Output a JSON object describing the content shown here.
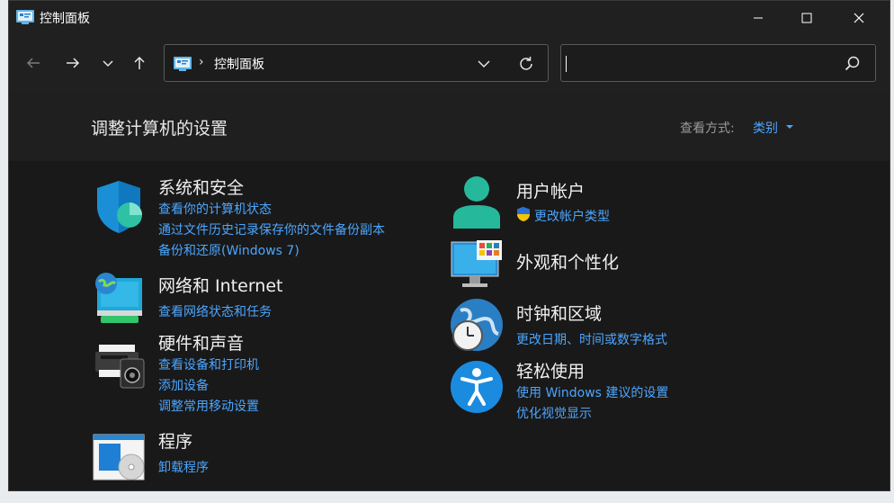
{
  "window": {
    "title": "控制面板",
    "controls": [
      "minimize-icon",
      "maximize-icon",
      "close-icon"
    ]
  },
  "navigation": {
    "back": "back-arrow-icon",
    "forward": "forward-arrow-icon",
    "recent": "chevron-down-icon",
    "up": "up-arrow-icon",
    "address": {
      "separator": "›",
      "path": "控制面板"
    },
    "search": {
      "value": "",
      "placeholder": ""
    }
  },
  "header": {
    "heading": "调整计算机的设置",
    "view_by_label": "查看方式:",
    "view_by_value": "类别"
  },
  "categories_left": [
    {
      "title": "系统和安全",
      "links": [
        "查看你的计算机状态",
        "通过文件历史记录保存你的文件备份副本",
        "备份和还原(Windows 7)"
      ]
    },
    {
      "title": "网络和 Internet",
      "links": [
        "查看网络状态和任务"
      ]
    },
    {
      "title": "硬件和声音",
      "links": [
        "查看设备和打印机",
        "添加设备",
        "调整常用移动设置"
      ]
    },
    {
      "title": "程序",
      "links": [
        "卸载程序"
      ]
    }
  ],
  "categories_right": [
    {
      "title": "用户帐户",
      "links": [
        "更改帐户类型"
      ]
    },
    {
      "title": "外观和个性化",
      "links": []
    },
    {
      "title": "时钟和区域",
      "links": [
        "更改日期、时间或数字格式"
      ]
    },
    {
      "title": "轻松使用",
      "links": [
        "使用 Windows 建议的设置",
        "优化视觉显示"
      ]
    }
  ],
  "colors": {
    "accent": "#4ca6ff",
    "window_bg": "#191919",
    "titlebar_bg": "#202020"
  }
}
